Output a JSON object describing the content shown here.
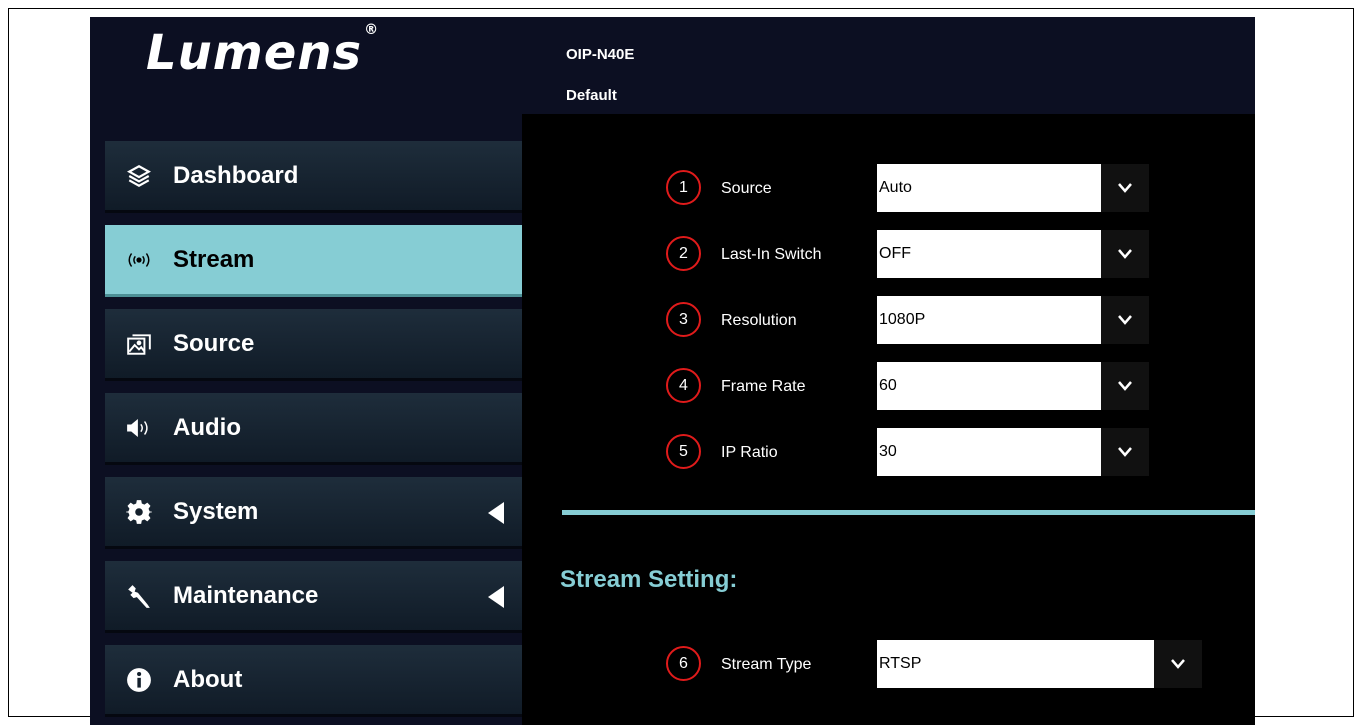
{
  "brand": {
    "logo_text": "Lumens",
    "registered": "®"
  },
  "header": {
    "model": "OIP-N40E",
    "profile": "Default"
  },
  "sidebar": {
    "items": [
      {
        "label": "Dashboard",
        "icon": "layers-icon"
      },
      {
        "label": "Stream",
        "icon": "broadcast-icon",
        "active": true
      },
      {
        "label": "Source",
        "icon": "image-source-icon"
      },
      {
        "label": "Audio",
        "icon": "speaker-icon"
      },
      {
        "label": "System",
        "icon": "gear-icon",
        "submenu": true
      },
      {
        "label": "Maintenance",
        "icon": "wrench-icon",
        "submenu": true
      },
      {
        "label": "About",
        "icon": "info-icon"
      }
    ]
  },
  "settings": [
    {
      "num": "1",
      "label": "Source",
      "value": "Auto"
    },
    {
      "num": "2",
      "label": "Last-In Switch",
      "value": "OFF"
    },
    {
      "num": "3",
      "label": "Resolution",
      "value": "1080P"
    },
    {
      "num": "4",
      "label": "Frame Rate",
      "value": "60"
    },
    {
      "num": "5",
      "label": "IP Ratio",
      "value": "30"
    }
  ],
  "stream_setting": {
    "title": "Stream Setting:",
    "stream_type": {
      "num": "6",
      "label": "Stream Type",
      "value": "RTSP"
    }
  },
  "colors": {
    "accent": "#86cdd4",
    "badge": "#e01b1b",
    "panel": "#0c0f22"
  }
}
